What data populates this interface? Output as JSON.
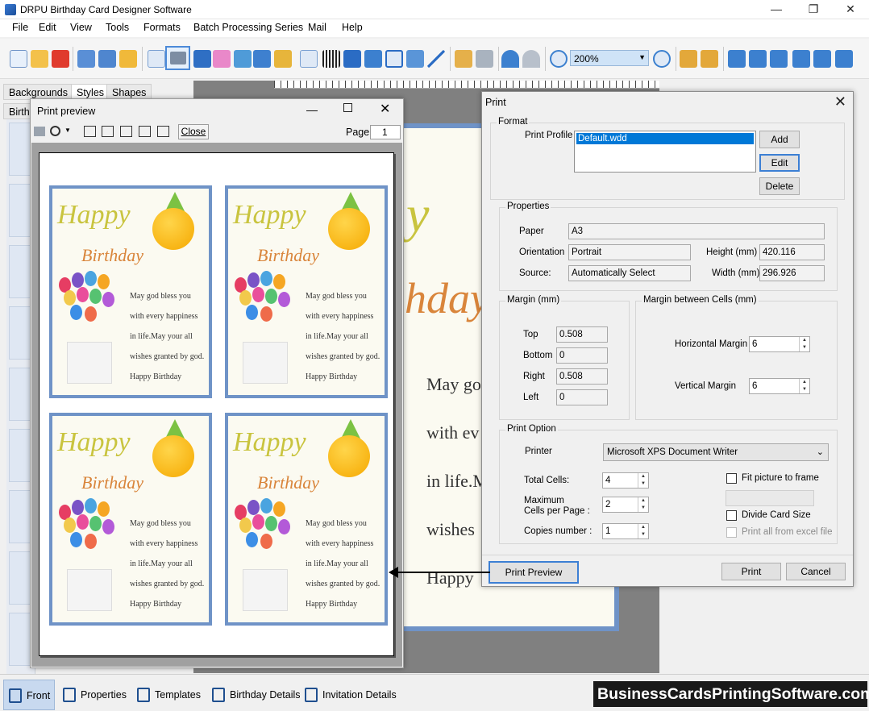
{
  "app": {
    "title": "DRPU Birthday Card Designer Software"
  },
  "window_controls": {
    "minimize": "—",
    "maximize": "❐",
    "close": "✕"
  },
  "menu": [
    "File",
    "Edit",
    "View",
    "Tools",
    "Formats",
    "Batch Processing Series",
    "Mail",
    "Help"
  ],
  "toolbar": {
    "zoom": "200%"
  },
  "left_tabs": [
    "Backgrounds",
    "Styles",
    "Shapes"
  ],
  "left_sub_tab": "Birth",
  "canvas_card": {
    "big_letters": "y",
    "big_birthday": "hday",
    "lines": [
      "May go",
      "with ev",
      "in life.M",
      "wishes",
      "Happy"
    ]
  },
  "print_preview": {
    "title": "Print preview",
    "close_label": "Close",
    "page_label": "Page",
    "page_value": "1",
    "card": {
      "happy": "Happy",
      "birthday": "Birthday",
      "lines": [
        "May god bless you",
        "with every happiness",
        "in life.May your all",
        "wishes granted by god.",
        "Happy Birthday"
      ]
    }
  },
  "print_dialog": {
    "title": "Print",
    "format": {
      "label": "Format",
      "print_profile_label": "Print Profile",
      "profile_selected": "Default.wdd",
      "add": "Add",
      "edit": "Edit",
      "delete": "Delete"
    },
    "properties": {
      "label": "Properties",
      "paper_label": "Paper",
      "paper": "A3",
      "orientation_label": "Orientation",
      "orientation": "Portrait",
      "source_label": "Source:",
      "source": "Automatically Select",
      "height_label": "Height (mm)",
      "height": "420.116",
      "width_label": "Width (mm)",
      "width": "296.926"
    },
    "margin": {
      "label": "Margin (mm)",
      "top_label": "Top",
      "top": "0.508",
      "bottom_label": "Bottom",
      "bottom": "0",
      "right_label": "Right",
      "right": "0.508",
      "left_label": "Left",
      "left": "0"
    },
    "cell_margin": {
      "label": "Margin between Cells (mm)",
      "horizontal_label": "Horizontal Margin",
      "horizontal": "6",
      "vertical_label": "Vertical Margin",
      "vertical": "6"
    },
    "print_option": {
      "label": "Print Option",
      "printer_label": "Printer",
      "printer": "Microsoft XPS Document Writer",
      "total_cells_label": "Total Cells:",
      "total_cells": "4",
      "max_cells_label_1": "Maximum",
      "max_cells_label_2": "Cells per Page :",
      "max_cells": "2",
      "copies_label": "Copies number :",
      "copies": "1",
      "fit_picture": "Fit picture to frame",
      "divide_card": "Divide Card Size",
      "print_all_excel": "Print all from excel file"
    },
    "buttons": {
      "print_preview": "Print Preview",
      "print": "Print",
      "cancel": "Cancel"
    }
  },
  "bottom_tabs": [
    "Front",
    "Properties",
    "Templates",
    "Birthday Details",
    "Invitation Details"
  ],
  "watermark": "BusinessCardsPrintingSoftware.com"
}
